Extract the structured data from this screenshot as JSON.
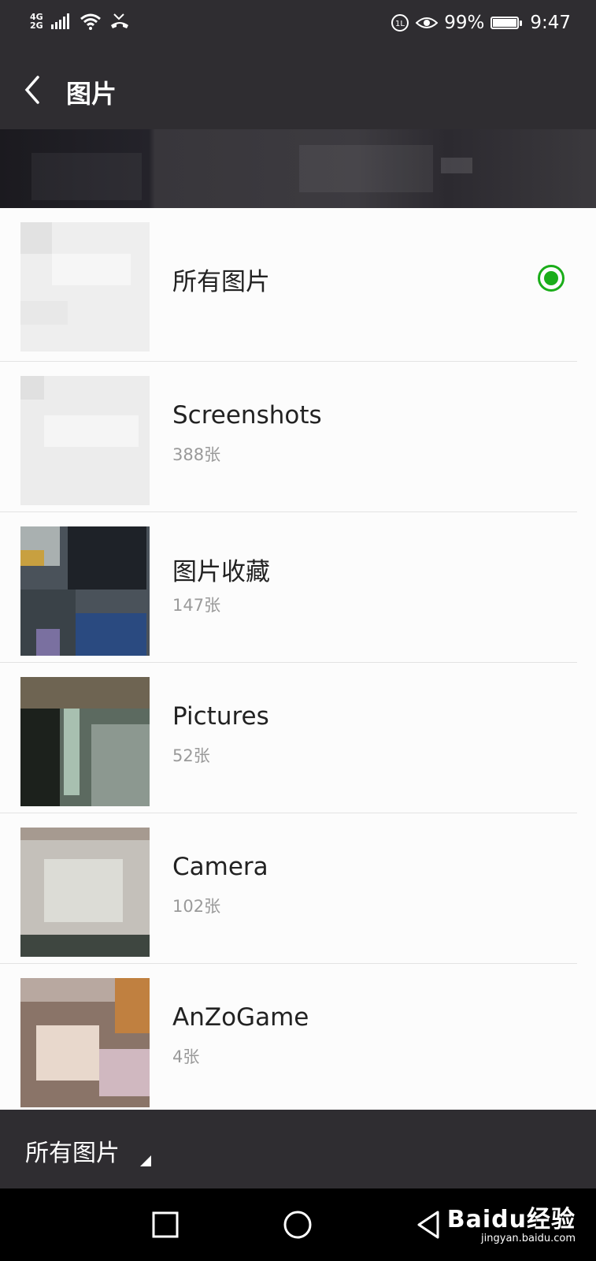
{
  "status_bar": {
    "network_top": "4G",
    "network_bottom": "2G",
    "battery": "99%",
    "time": "9:47"
  },
  "header": {
    "title": "图片"
  },
  "albums": [
    {
      "name": "所有图片",
      "count": "",
      "selected": true
    },
    {
      "name": "Screenshots",
      "count": "388张",
      "selected": false
    },
    {
      "name": "图片收藏",
      "count": "147张",
      "selected": false
    },
    {
      "name": "Pictures",
      "count": "52张",
      "selected": false
    },
    {
      "name": "Camera",
      "count": "102张",
      "selected": false
    },
    {
      "name": "AnZoGame",
      "count": "4张",
      "selected": false
    }
  ],
  "bottom_bar": {
    "folder_label": "所有图片"
  },
  "watermark": {
    "logo": "Baidu经验",
    "url": "jingyan.baidu.com"
  },
  "colors": {
    "bar_bg": "#2f2d31",
    "accent_green": "#1aad19",
    "count_gray": "#9a9a9a"
  }
}
